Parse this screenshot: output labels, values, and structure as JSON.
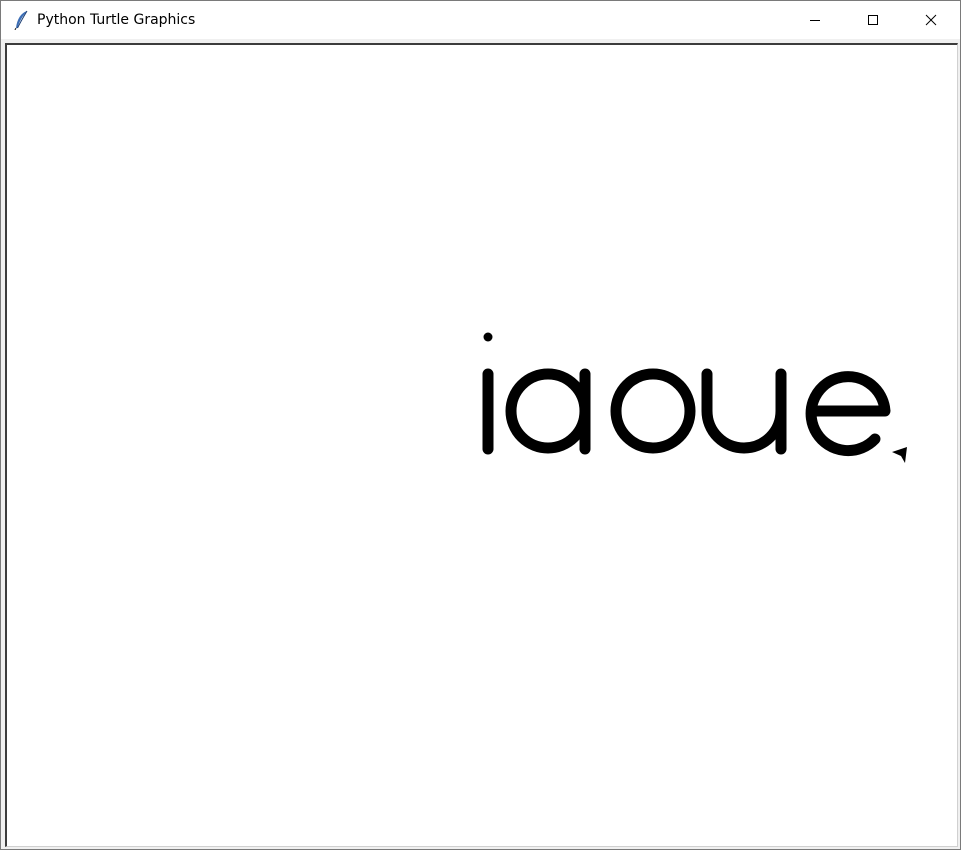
{
  "window": {
    "title": "Python Turtle Graphics",
    "app_icon": "feather-icon",
    "controls": {
      "minimize_icon": "minimize-icon",
      "maximize_icon": "maximize-icon",
      "close_icon": "close-icon"
    }
  },
  "canvas": {
    "background_color": "#ffffff",
    "ink_color": "#000000",
    "drawn_text": "iaoue",
    "turtle_icon": "turtle-arrow-icon"
  }
}
